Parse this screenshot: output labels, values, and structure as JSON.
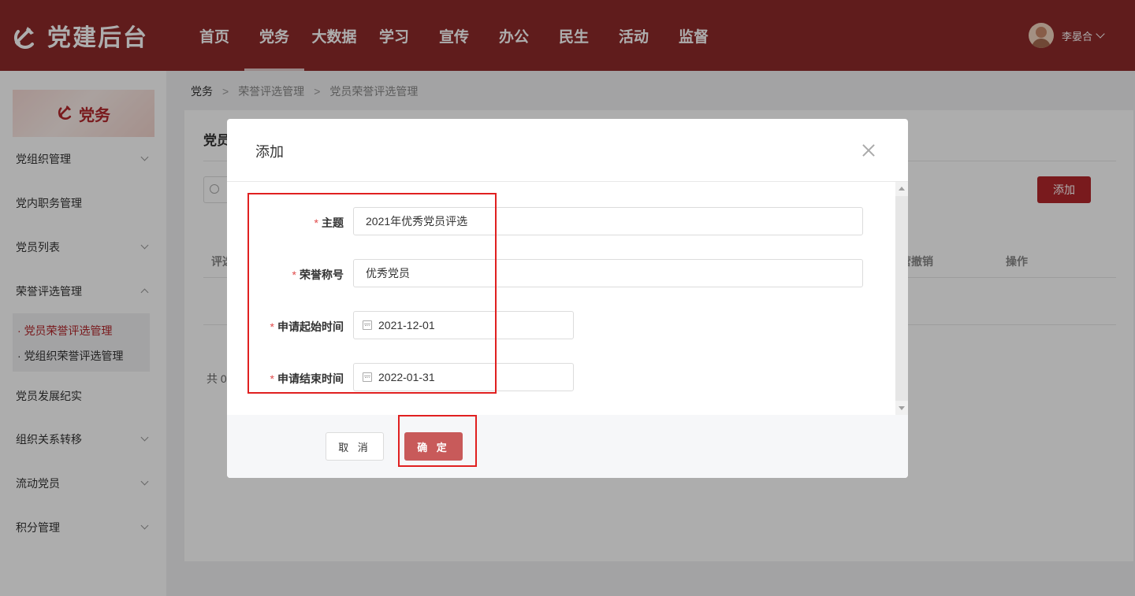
{
  "header": {
    "logo_text": "党建后台",
    "nav": [
      "首页",
      "党务",
      "大数据",
      "学习",
      "宣传",
      "办公",
      "民生",
      "活动",
      "监督"
    ],
    "active_nav_index": 1,
    "user_name": "李晏合"
  },
  "sidebar": {
    "banner_label": "党务",
    "items": [
      {
        "label": "党组织管理",
        "expandable": true
      },
      {
        "label": "党内职务管理",
        "expandable": false
      },
      {
        "label": "党员列表",
        "expandable": true
      },
      {
        "label": "荣誉评选管理",
        "expandable": true,
        "expanded": true
      },
      {
        "label": "党员发展纪实",
        "expandable": false
      },
      {
        "label": "组织关系转移",
        "expandable": true
      },
      {
        "label": "流动党员",
        "expandable": true
      },
      {
        "label": "积分管理",
        "expandable": true
      }
    ],
    "sub_items": [
      {
        "label": "党员荣誉评选管理",
        "active": true
      },
      {
        "label": "党组织荣誉评选管理",
        "active": false
      }
    ]
  },
  "breadcrumb": [
    "党务",
    "荣誉评选管理",
    "党员荣誉评选管理"
  ],
  "panel": {
    "title_partial": "党员",
    "add_button": "添加",
    "columns": [
      {
        "label": "评选"
      },
      {
        "label": "营撤销"
      },
      {
        "label": "操作"
      }
    ],
    "total_partial": "共 0"
  },
  "modal": {
    "title": "添加",
    "fields": [
      {
        "label": "主题",
        "value": "2021年优秀党员评选",
        "type": "text",
        "required": true
      },
      {
        "label": "荣誉称号",
        "value": "优秀党员",
        "type": "text",
        "required": true
      },
      {
        "label": "申请起始时间",
        "value": "2021-12-01",
        "type": "date",
        "required": true
      },
      {
        "label": "申请结束时间",
        "value": "2022-01-31",
        "type": "date",
        "required": true
      }
    ],
    "required_mark": "*",
    "cancel_label": "取 消",
    "ok_label": "确 定"
  },
  "colors": {
    "brand": "#8e2a2a",
    "accent": "#b3272c",
    "confirm_button": "#c85a5a",
    "annotation": "#e02020"
  }
}
